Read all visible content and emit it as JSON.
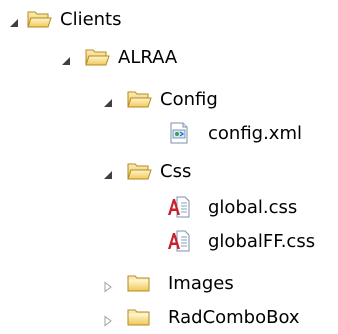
{
  "tree": {
    "items": [
      {
        "label": "Clients",
        "icon": "folder-open-icon",
        "state": "expanded"
      },
      {
        "label": "ALRAA",
        "icon": "folder-open-icon",
        "state": "expanded"
      },
      {
        "label": "Config",
        "icon": "folder-open-icon",
        "state": "expanded"
      },
      {
        "label": "config.xml",
        "icon": "xml-file-icon",
        "state": "leaf"
      },
      {
        "label": "Css",
        "icon": "folder-open-icon",
        "state": "expanded"
      },
      {
        "label": "global.css",
        "icon": "css-file-icon",
        "state": "leaf"
      },
      {
        "label": "globalFF.css",
        "icon": "css-file-icon",
        "state": "leaf"
      },
      {
        "label": "Images",
        "icon": "folder-closed-icon",
        "state": "collapsed"
      },
      {
        "label": "RadComboBox",
        "icon": "folder-closed-icon",
        "state": "collapsed"
      }
    ]
  },
  "colors": {
    "expanded_arrow": "#404040",
    "collapsed_arrow": "#a0a0a0",
    "folder_body": "#e7b94a",
    "folder_light": "#fbe7a3"
  }
}
